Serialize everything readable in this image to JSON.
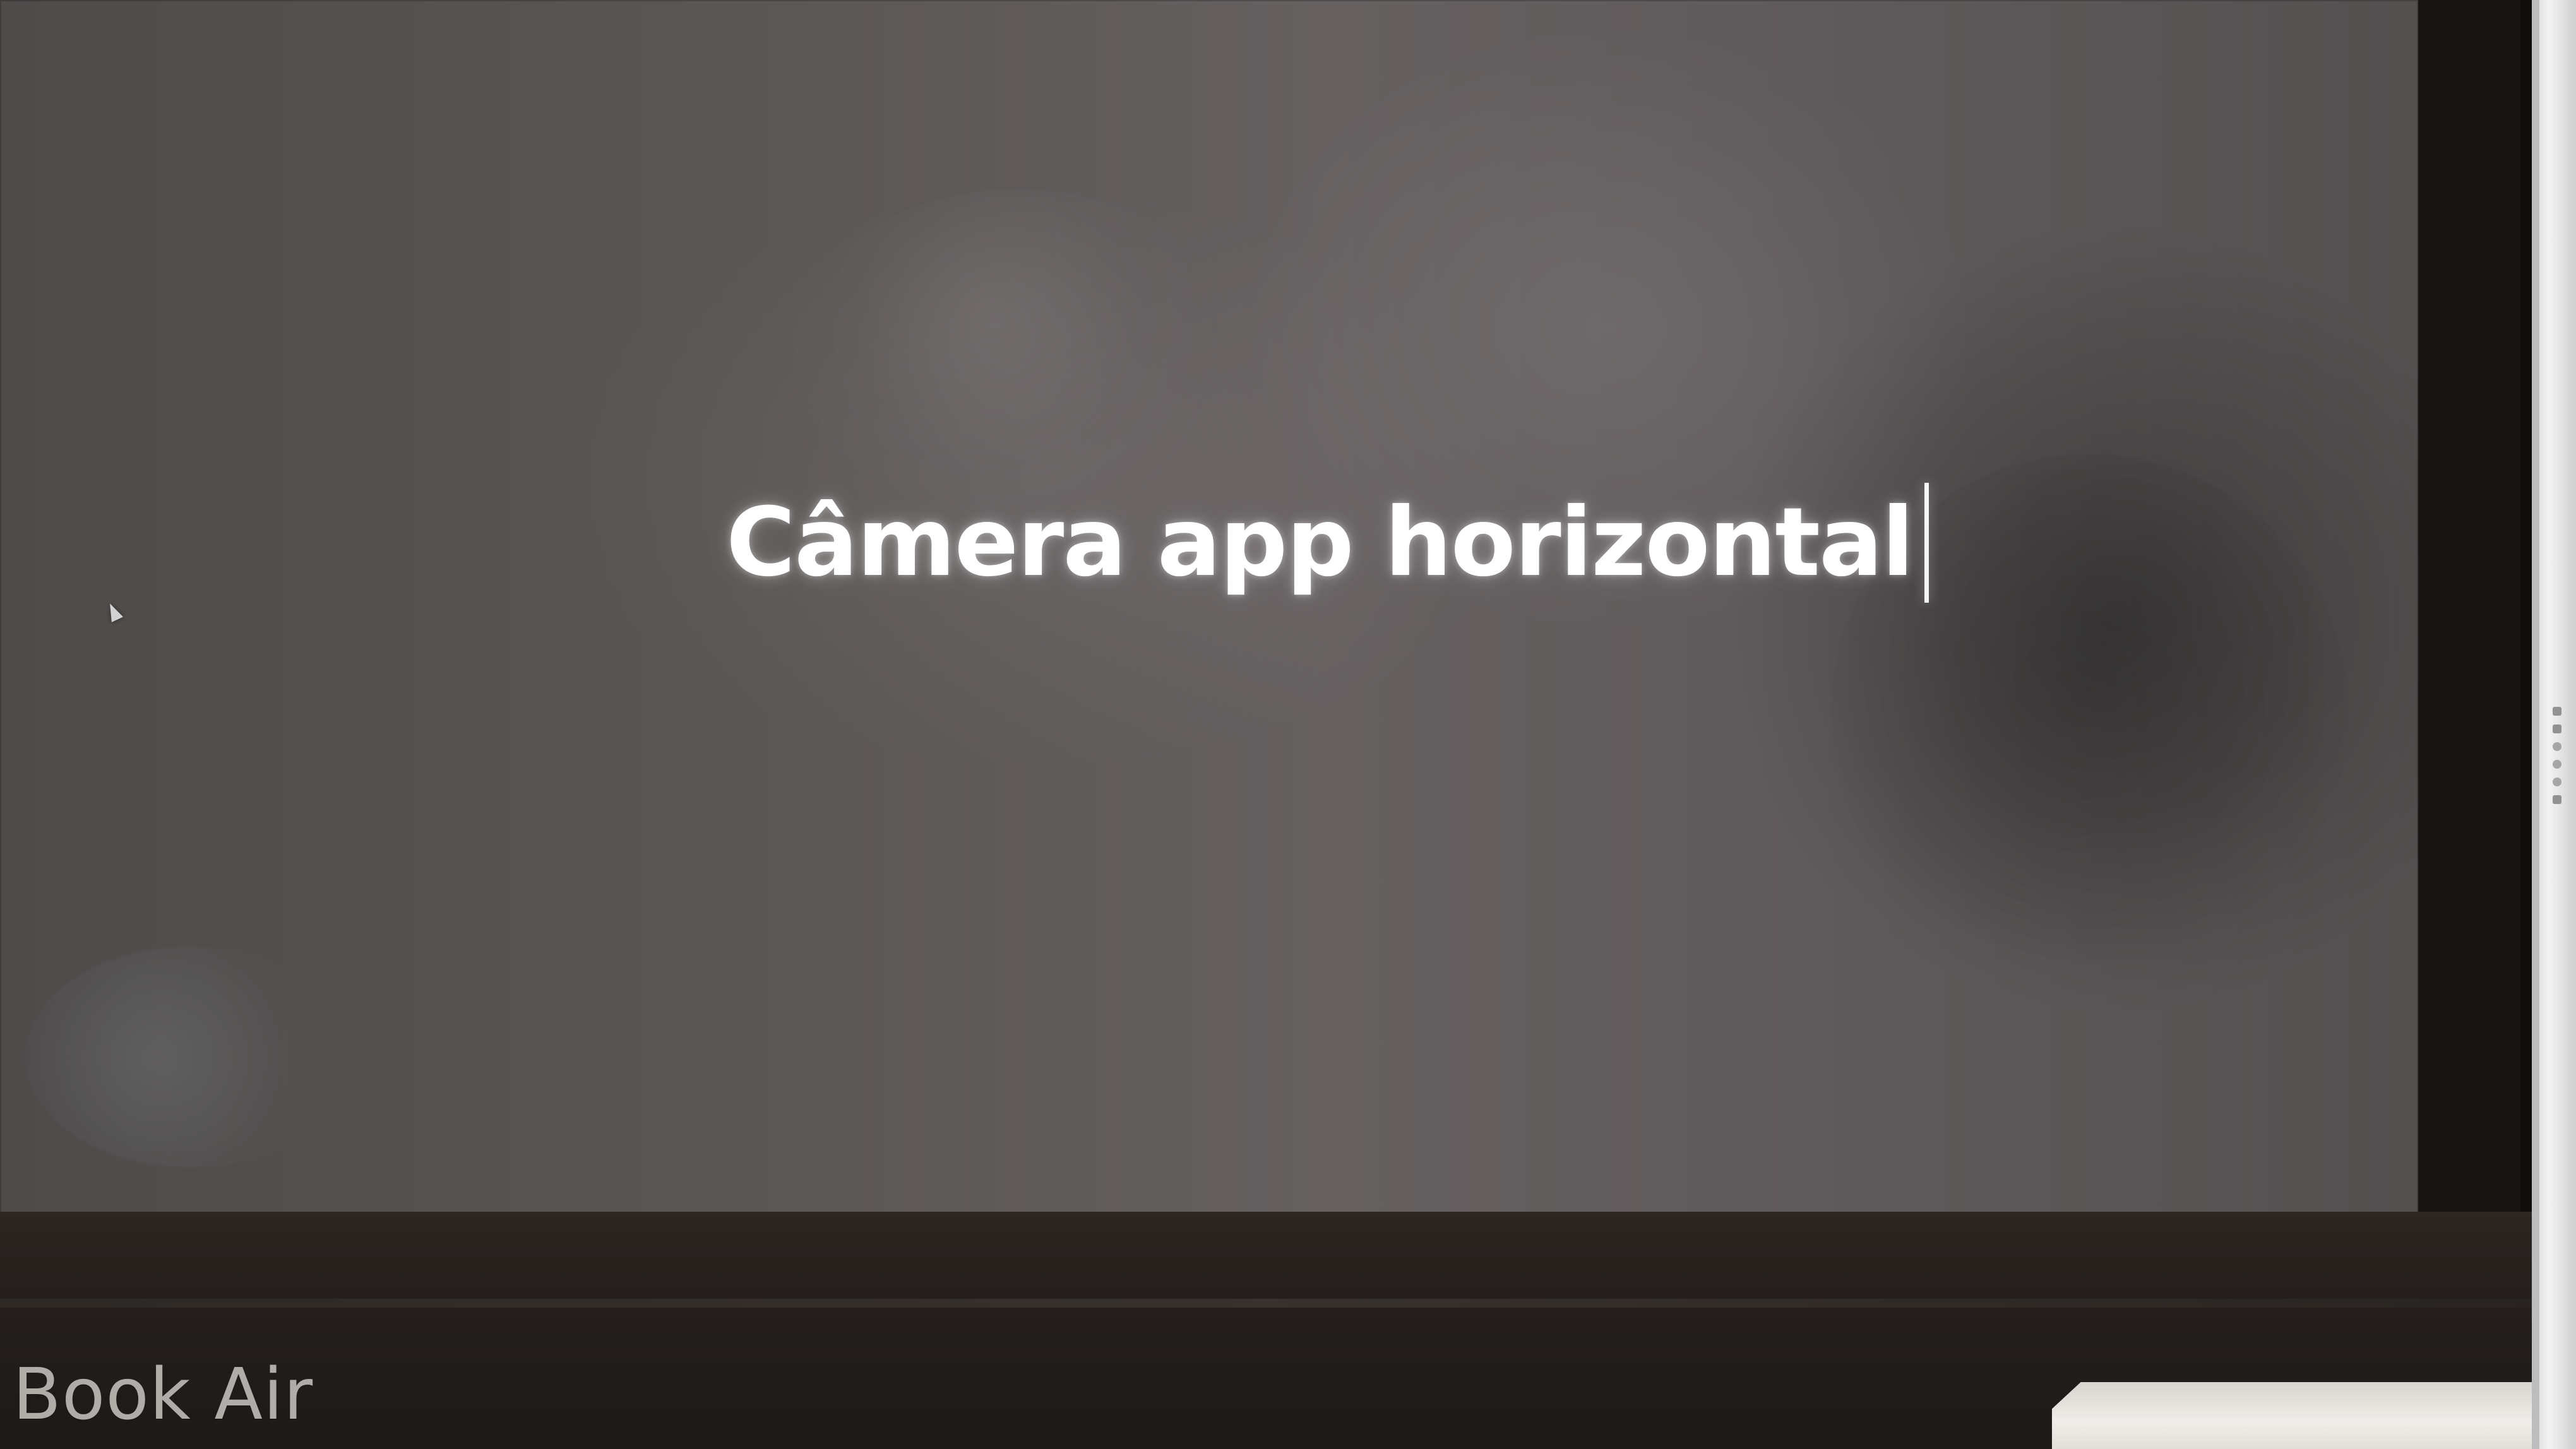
{
  "screen": {
    "typed_text": "Câmera app horizontal"
  },
  "bezel": {
    "brand_text": "Book Air"
  },
  "icons": {
    "pointer": "mouse-pointer-icon",
    "side_glyphs": "side-ui-glyphs-icon"
  },
  "colors": {
    "screen_base": "#5a5654",
    "text": "#ffffff",
    "bezel": "#171514",
    "bottom_panel": "#2c2622",
    "side_object": "#f2f2f2"
  }
}
